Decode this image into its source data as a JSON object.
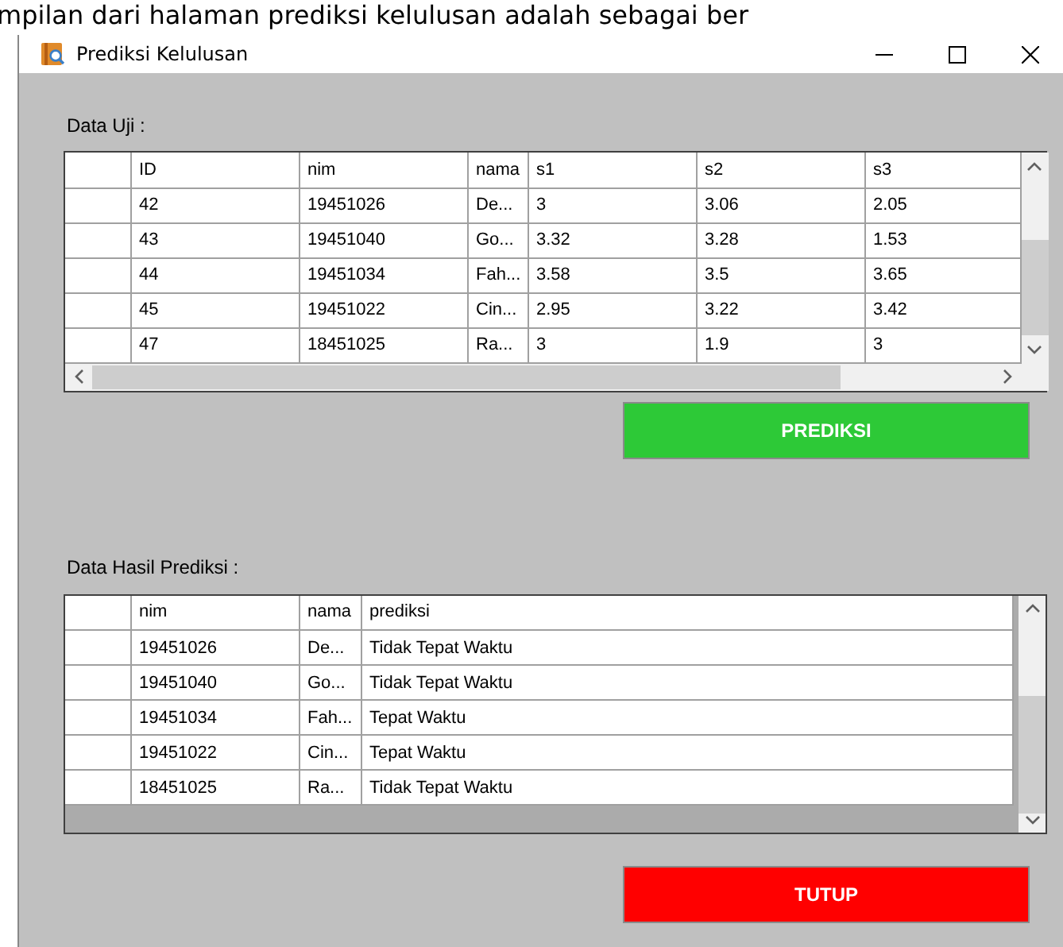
{
  "document_text": "mpilan dari halaman prediksi kelulusan adalah sebagai ber",
  "window": {
    "title": "Prediksi Kelulusan"
  },
  "test_data": {
    "label": "Data Uji :",
    "columns": [
      "ID",
      "nim",
      "nama",
      "s1",
      "s2",
      "s3"
    ],
    "rows": [
      [
        "42",
        "19451026",
        "De...",
        "3",
        "3.06",
        "2.05"
      ],
      [
        "43",
        "19451040",
        "Go...",
        "3.32",
        "3.28",
        "1.53"
      ],
      [
        "44",
        "19451034",
        "Fah...",
        "3.58",
        "3.5",
        "3.65"
      ],
      [
        "45",
        "19451022",
        "Cin...",
        "2.95",
        "3.22",
        "3.42"
      ],
      [
        "47",
        "18451025",
        "Ra...",
        "3",
        "1.9",
        "3"
      ]
    ]
  },
  "predict_button": "PREDIKSI",
  "results": {
    "label": "Data Hasil Prediksi :",
    "columns": [
      "nim",
      "nama",
      "prediksi"
    ],
    "rows": [
      [
        "19451026",
        "De...",
        "Tidak Tepat Waktu"
      ],
      [
        "19451040",
        "Go...",
        "Tidak Tepat Waktu"
      ],
      [
        "19451034",
        "Fah...",
        "Tepat Waktu"
      ],
      [
        "19451022",
        "Cin...",
        "Tepat Waktu"
      ],
      [
        "18451025",
        "Ra...",
        "Tidak Tepat Waktu"
      ]
    ]
  },
  "close_button": "TUTUP"
}
